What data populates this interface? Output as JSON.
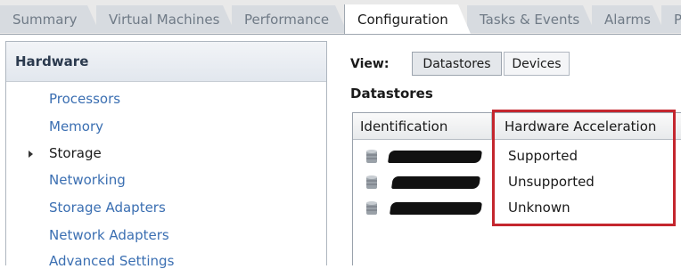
{
  "tabs": [
    {
      "label": "Summary",
      "active": false
    },
    {
      "label": "Virtual Machines",
      "active": false
    },
    {
      "label": "Performance",
      "active": false
    },
    {
      "label": "Configuration",
      "active": true
    },
    {
      "label": "Tasks & Events",
      "active": false
    },
    {
      "label": "Alarms",
      "active": false
    },
    {
      "label": "P",
      "active": false
    }
  ],
  "hardware": {
    "title": "Hardware",
    "items": [
      {
        "label": "Processors"
      },
      {
        "label": "Memory"
      },
      {
        "label": "Storage",
        "current": true
      },
      {
        "label": "Networking"
      },
      {
        "label": "Storage Adapters"
      },
      {
        "label": "Network Adapters"
      },
      {
        "label": "Advanced Settings"
      }
    ]
  },
  "view": {
    "label": "View:",
    "buttons": [
      {
        "label": "Datastores",
        "active": true
      },
      {
        "label": "Devices",
        "active": false
      }
    ]
  },
  "datastores": {
    "title": "Datastores",
    "columns": [
      "Identification",
      "Hardware Acceleration"
    ],
    "rows": [
      {
        "identification": "[redacted]",
        "hardware_acceleration": "Supported"
      },
      {
        "identification": "[redacted]",
        "hardware_acceleration": "Unsupported"
      },
      {
        "identification": "[redacted]",
        "hardware_acceleration": "Unknown"
      }
    ]
  },
  "icons": {
    "datastore": "database-icon",
    "expand": "expand-arrow-icon"
  },
  "colors": {
    "highlight": "#c4262e",
    "link": "#3b6fb2",
    "header_text": "#2b3a4e"
  }
}
